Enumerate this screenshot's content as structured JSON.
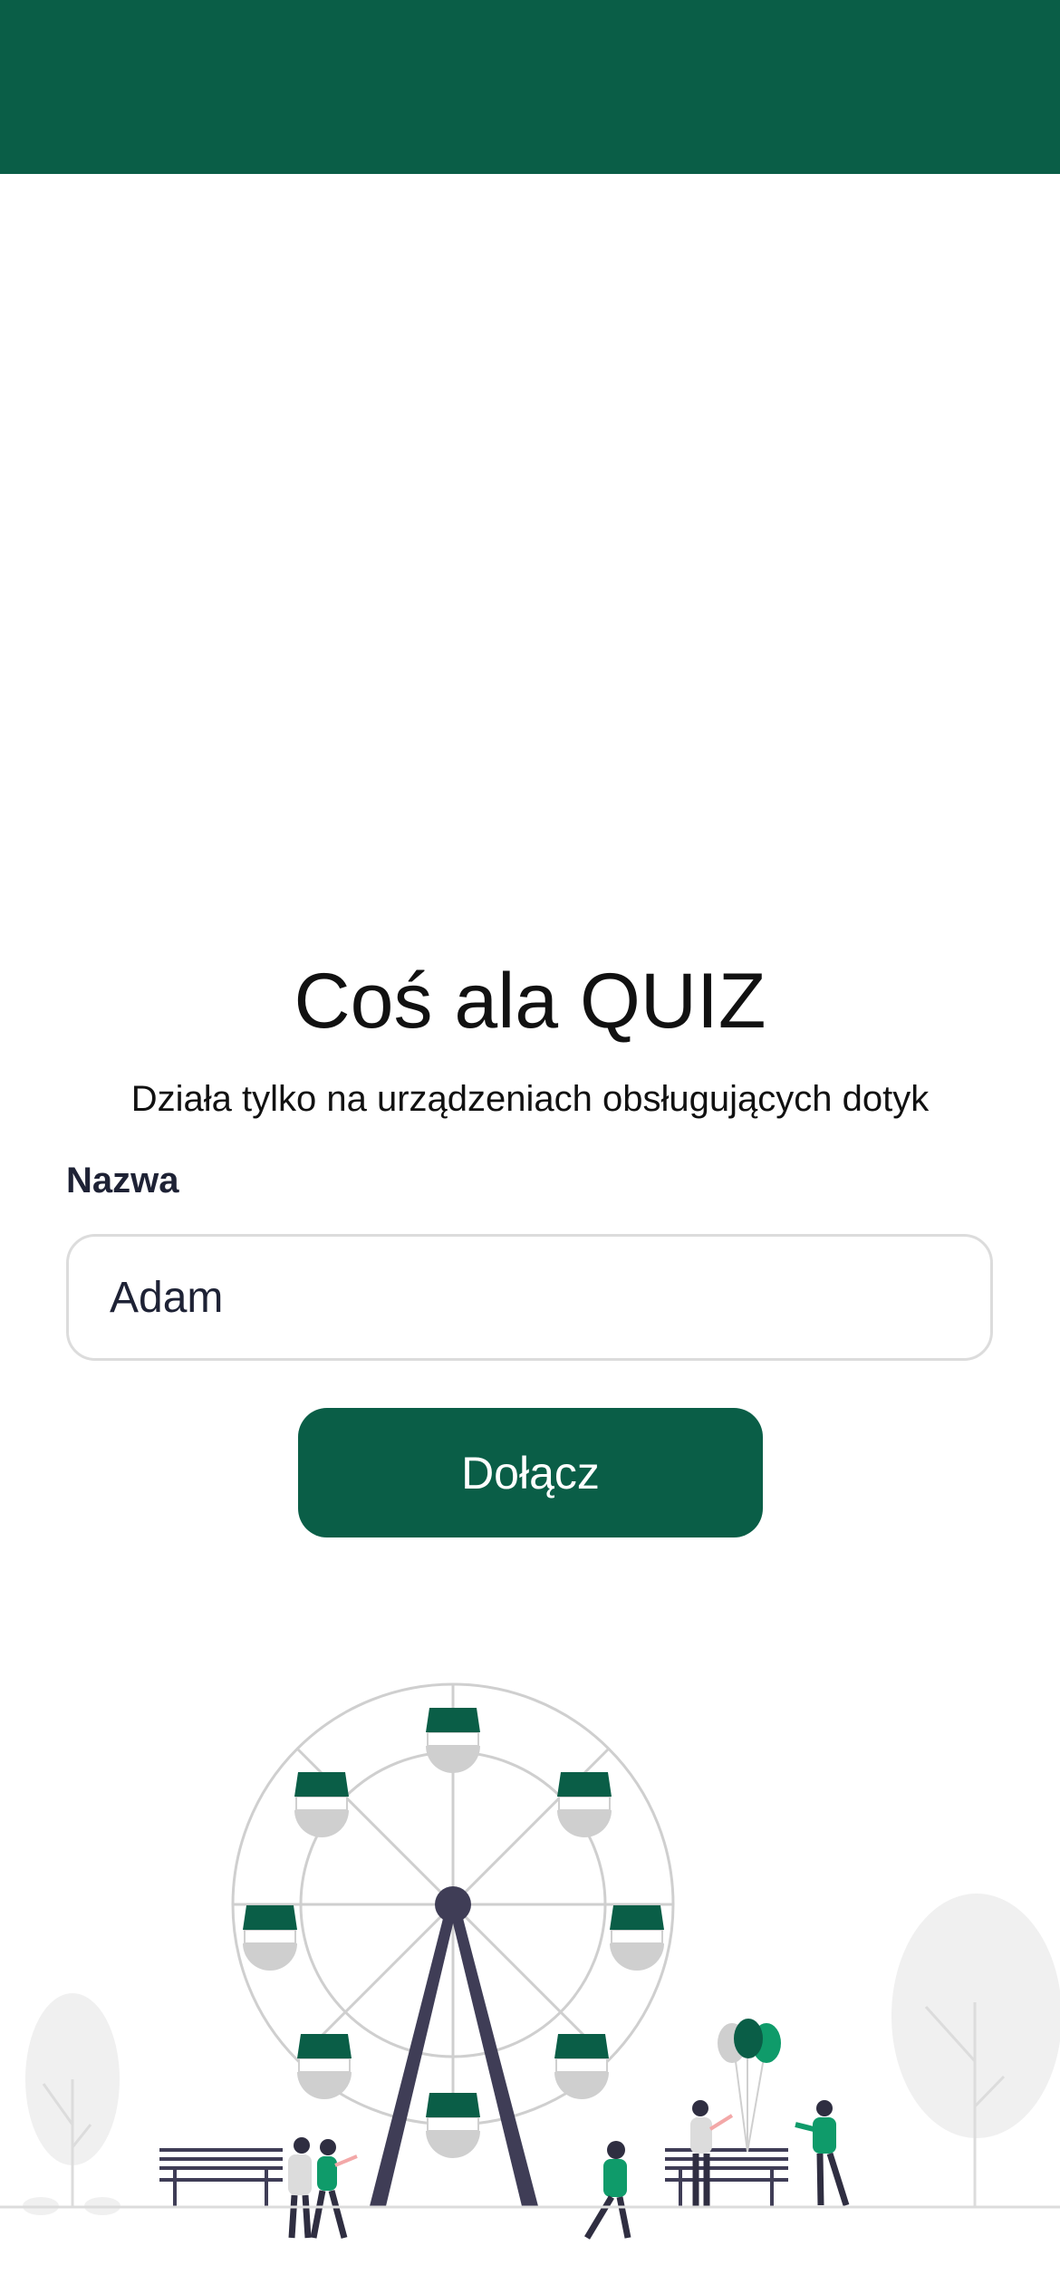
{
  "app": {
    "title": "Coś ala QUIZ",
    "subtitle": "Działa tylko na urządzeniach obsługujących dotyk"
  },
  "form": {
    "name_label": "Nazwa",
    "name_value": "Adam",
    "join_label": "Dołącz"
  },
  "colors": {
    "brand": "#0a5e47",
    "accent_green": "#0f9b6a",
    "gray": "#cfcfcf",
    "dark": "#3f3d56"
  },
  "icons": [
    "ferris-wheel-illustration"
  ]
}
